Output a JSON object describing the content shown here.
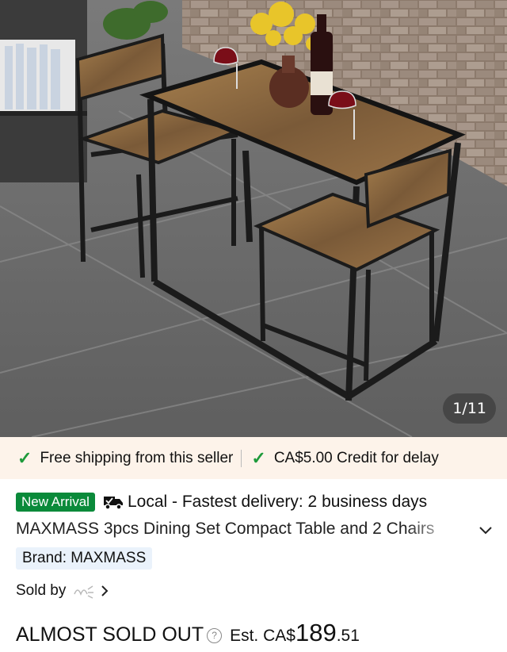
{
  "gallery": {
    "counter": "1/11",
    "image_subject": "dining-set-photo"
  },
  "shipping_bar": {
    "free_shipping": "Free shipping from this seller",
    "credit": "CA$5.00 Credit for delay",
    "check_color": "#1e9a3b"
  },
  "product": {
    "badge": "New Arrival",
    "badge_color": "#0a8a3a",
    "delivery_icon": "truck-icon",
    "delivery": "Local - Fastest delivery: 2 business days",
    "title": "MAXMASS 3pcs Dining Set Compact Table and 2 Chairs",
    "brand": "Brand: MAXMASS",
    "sold_by": "Sold by",
    "stock_status": "ALMOST SOLD OUT",
    "est_prefix": "Est. CA$",
    "price_whole": "189",
    "price_cents": ".51"
  }
}
